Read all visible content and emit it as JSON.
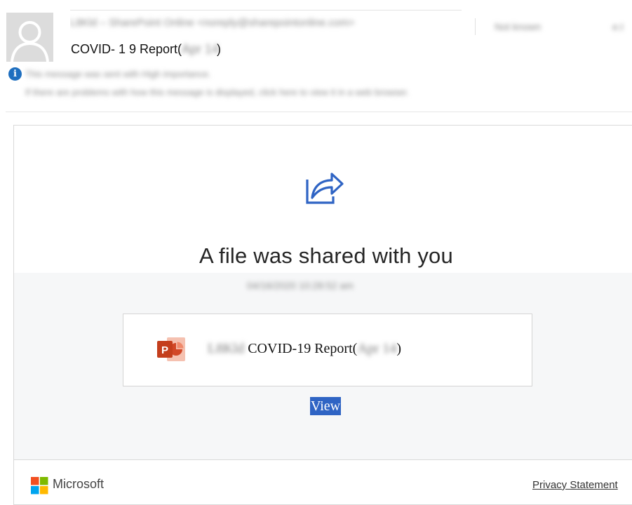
{
  "header": {
    "from_text": "L8Kld – SharePoint Online <noreply@sharepointonline.com>",
    "recipient": "Not known",
    "recipient_extra": "e.t",
    "subject_prefix": "COVID- 1 9  Report(",
    "subject_date": "Apr 14",
    "subject_suffix": ")",
    "notice_line1": "This message was sent with High importance.",
    "notice_line2": "If there are problems with how this message is displayed, click here to view it in a web browser."
  },
  "email": {
    "headline": "A file was shared with you",
    "timestamp": "04/16/2020 10:28:52 am",
    "file": {
      "icon": "powerpoint-icon",
      "prefix": "L8Kld",
      "name": "COVID-19 Report(",
      "date": "Apr 14",
      "suffix": ")"
    },
    "view_label": "View",
    "footer": {
      "brand": "Microsoft",
      "privacy_label": "Privacy Statement"
    }
  },
  "colors": {
    "accent": "#2f64c4",
    "info": "#1d6ebf",
    "ms_red": "#f25022",
    "ms_green": "#7fba00",
    "ms_blue": "#00a4ef",
    "ms_yellow": "#ffb900",
    "ppt_red": "#d24726"
  }
}
